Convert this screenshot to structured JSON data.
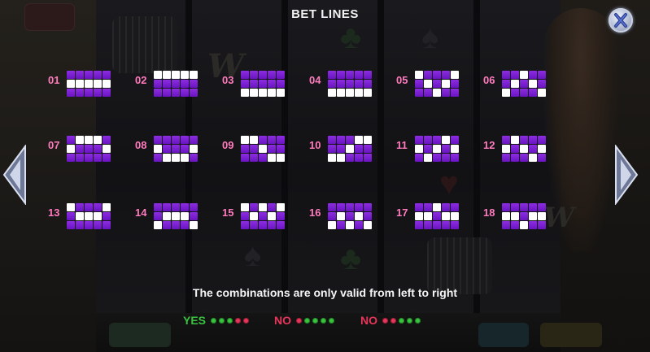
{
  "title": "BET LINES",
  "colors": {
    "cell_purple": "#7a1fd4",
    "cell_highlight": "#ffffff",
    "line_number": "#ff7bbd",
    "yes_green": "#39c43f",
    "no_red": "#e8365b"
  },
  "icons": {
    "close": "close-x-icon",
    "prev": "arrow-left-icon",
    "next": "arrow-right-icon"
  },
  "lines": [
    {
      "label": "01",
      "pattern": [
        1,
        1,
        1,
        1,
        1
      ]
    },
    {
      "label": "02",
      "pattern": [
        0,
        0,
        0,
        0,
        0
      ]
    },
    {
      "label": "03",
      "pattern": [
        2,
        2,
        2,
        2,
        2
      ]
    },
    {
      "label": "04",
      "pattern": [
        2,
        2,
        2,
        2,
        2
      ]
    },
    {
      "label": "05",
      "pattern": [
        0,
        1,
        2,
        1,
        0
      ]
    },
    {
      "label": "06",
      "pattern": [
        2,
        1,
        0,
        1,
        2
      ]
    },
    {
      "label": "07",
      "pattern": [
        1,
        0,
        0,
        0,
        1
      ]
    },
    {
      "label": "08",
      "pattern": [
        1,
        2,
        2,
        2,
        1
      ]
    },
    {
      "label": "09",
      "pattern": [
        0,
        0,
        1,
        2,
        2
      ]
    },
    {
      "label": "10",
      "pattern": [
        2,
        2,
        1,
        0,
        0
      ]
    },
    {
      "label": "11",
      "pattern": [
        1,
        2,
        1,
        0,
        1
      ]
    },
    {
      "label": "12",
      "pattern": [
        1,
        0,
        1,
        2,
        1
      ]
    },
    {
      "label": "13",
      "pattern": [
        0,
        1,
        1,
        1,
        0
      ]
    },
    {
      "label": "14",
      "pattern": [
        2,
        1,
        1,
        1,
        2
      ]
    },
    {
      "label": "15",
      "pattern": [
        0,
        1,
        0,
        1,
        0
      ]
    },
    {
      "label": "16",
      "pattern": [
        2,
        1,
        2,
        1,
        2
      ]
    },
    {
      "label": "17",
      "pattern": [
        1,
        1,
        0,
        1,
        1
      ]
    },
    {
      "label": "18",
      "pattern": [
        1,
        1,
        2,
        1,
        1
      ]
    }
  ],
  "note": "The combinations are only valid from left to right",
  "legend": [
    {
      "label": "YES",
      "color": "#39c43f",
      "dots": [
        "g",
        "g",
        "g",
        "r",
        "r"
      ]
    },
    {
      "label": "NO",
      "color": "#e8365b",
      "dots": [
        "r",
        "g",
        "g",
        "g",
        "g"
      ]
    },
    {
      "label": "NO",
      "color": "#e8365b",
      "dots": [
        "r",
        "r",
        "g",
        "g",
        "g"
      ]
    }
  ]
}
